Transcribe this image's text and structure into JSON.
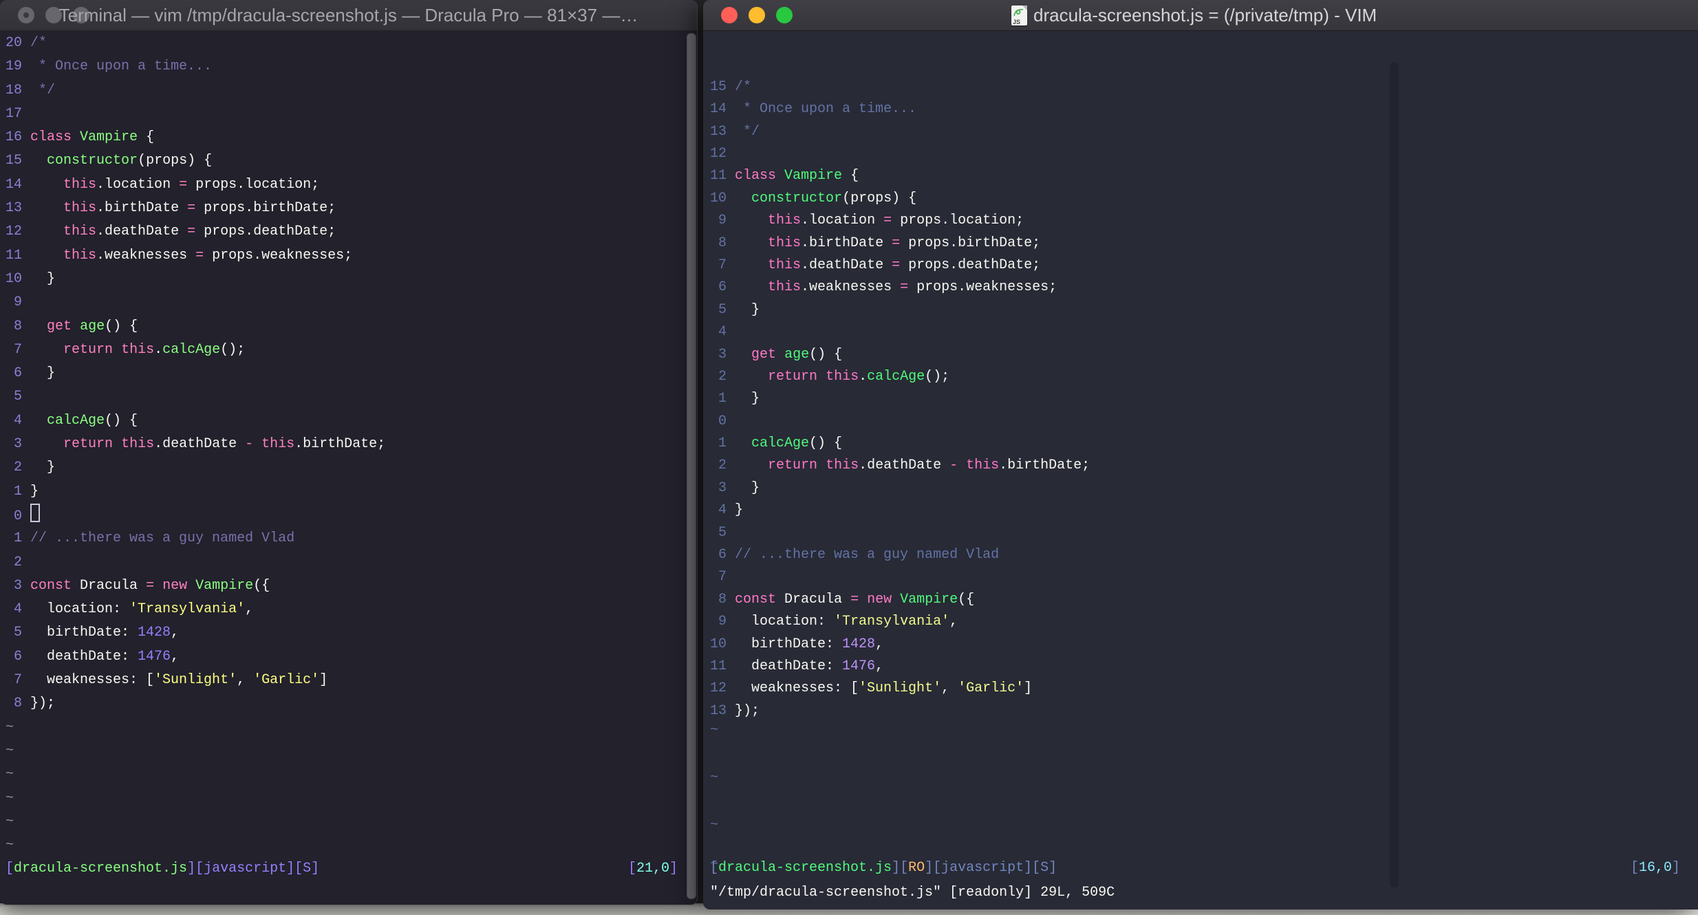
{
  "left_window": {
    "title": "Terminal — vim /tmp/dracula-screenshot.js — Dracula Pro — 81×37 —…",
    "cursor_line": 21,
    "tilde": "~",
    "tilde_count": 6,
    "gutter": [
      "20",
      "19",
      "18",
      "17",
      "16",
      "15",
      "14",
      "13",
      "12",
      "11",
      "10",
      " 9",
      " 8",
      " 7",
      " 6",
      " 5",
      " 4",
      " 3",
      " 2",
      " 1",
      " 0",
      " 1",
      " 2",
      " 3",
      " 4",
      " 5",
      " 6",
      " 7",
      " 8"
    ],
    "status": {
      "left": [
        [
          "br",
          "["
        ],
        [
          "file",
          "dracula-screenshot.js"
        ],
        [
          "br",
          "][javascript][S]"
        ]
      ],
      "right": [
        [
          "br",
          "["
        ],
        [
          "num",
          "21,0"
        ],
        [
          "br",
          "]"
        ]
      ]
    }
  },
  "right_window": {
    "title": "dracula-screenshot.js = (/private/tmp) - VIM",
    "icon_label": "JS",
    "cursor_line": 16,
    "tilde": "~",
    "tilde_count": 4,
    "gutter": [
      "15",
      "14",
      "13",
      "12",
      "11",
      "10",
      " 9",
      " 8",
      " 7",
      " 6",
      " 5",
      " 4",
      " 3",
      " 2",
      " 1",
      " 0",
      " 1",
      " 2",
      " 3",
      " 4",
      " 5",
      " 6",
      " 7",
      " 8",
      " 9",
      "10",
      "11",
      "12",
      "13"
    ],
    "status": {
      "left": [
        [
          "br",
          "["
        ],
        [
          "file",
          "dracula-screenshot.js"
        ],
        [
          "br",
          "]["
        ],
        [
          "ro",
          "RO"
        ],
        [
          "br",
          "][javascript][S]"
        ]
      ],
      "right": [
        [
          "br",
          "["
        ],
        [
          "num",
          "16,0"
        ],
        [
          "br",
          "]"
        ]
      ]
    },
    "cmdline": "\"/tmp/dracula-screenshot.js\" [readonly] 29L, 509C"
  },
  "code_lines": [
    {
      "toks": [
        [
          "c",
          "/*"
        ]
      ]
    },
    {
      "toks": [
        [
          "c",
          " * Once upon a time..."
        ]
      ]
    },
    {
      "toks": [
        [
          "c",
          " */"
        ]
      ]
    },
    {
      "toks": []
    },
    {
      "toks": [
        [
          "k",
          "class"
        ],
        [
          "v",
          " "
        ],
        [
          "f",
          "Vampire"
        ],
        [
          "v",
          " {"
        ]
      ]
    },
    {
      "toks": [
        [
          "v",
          "  "
        ],
        [
          "f",
          "constructor"
        ],
        [
          "v",
          "(props) {"
        ]
      ]
    },
    {
      "toks": [
        [
          "v",
          "    "
        ],
        [
          "k",
          "this"
        ],
        [
          "v",
          ".location "
        ],
        [
          "o",
          "="
        ],
        [
          "v",
          " props.location;"
        ]
      ]
    },
    {
      "toks": [
        [
          "v",
          "    "
        ],
        [
          "k",
          "this"
        ],
        [
          "v",
          ".birthDate "
        ],
        [
          "o",
          "="
        ],
        [
          "v",
          " props.birthDate;"
        ]
      ]
    },
    {
      "toks": [
        [
          "v",
          "    "
        ],
        [
          "k",
          "this"
        ],
        [
          "v",
          ".deathDate "
        ],
        [
          "o",
          "="
        ],
        [
          "v",
          " props.deathDate;"
        ]
      ]
    },
    {
      "toks": [
        [
          "v",
          "    "
        ],
        [
          "k",
          "this"
        ],
        [
          "v",
          ".weaknesses "
        ],
        [
          "o",
          "="
        ],
        [
          "v",
          " props.weaknesses;"
        ]
      ]
    },
    {
      "toks": [
        [
          "v",
          "  }"
        ]
      ]
    },
    {
      "toks": []
    },
    {
      "toks": [
        [
          "v",
          "  "
        ],
        [
          "k",
          "get"
        ],
        [
          "v",
          " "
        ],
        [
          "f",
          "age"
        ],
        [
          "v",
          "() {"
        ]
      ]
    },
    {
      "toks": [
        [
          "v",
          "    "
        ],
        [
          "k",
          "return"
        ],
        [
          "v",
          " "
        ],
        [
          "k",
          "this"
        ],
        [
          "v",
          "."
        ],
        [
          "f",
          "calcAge"
        ],
        [
          "v",
          "();"
        ]
      ]
    },
    {
      "toks": [
        [
          "v",
          "  }"
        ]
      ]
    },
    {
      "toks": []
    },
    {
      "toks": [
        [
          "v",
          "  "
        ],
        [
          "f",
          "calcAge"
        ],
        [
          "v",
          "() {"
        ]
      ]
    },
    {
      "toks": [
        [
          "v",
          "    "
        ],
        [
          "k",
          "return"
        ],
        [
          "v",
          " "
        ],
        [
          "k",
          "this"
        ],
        [
          "v",
          ".deathDate "
        ],
        [
          "o",
          "-"
        ],
        [
          "v",
          " "
        ],
        [
          "k",
          "this"
        ],
        [
          "v",
          ".birthDate;"
        ]
      ]
    },
    {
      "toks": [
        [
          "v",
          "  }"
        ]
      ]
    },
    {
      "toks": [
        [
          "v",
          "}"
        ]
      ]
    },
    {
      "toks": []
    },
    {
      "toks": [
        [
          "c",
          "// ...there was a guy named Vlad"
        ]
      ]
    },
    {
      "toks": []
    },
    {
      "toks": [
        [
          "k",
          "const"
        ],
        [
          "v",
          " Dracula "
        ],
        [
          "o",
          "="
        ],
        [
          "v",
          " "
        ],
        [
          "k",
          "new"
        ],
        [
          "v",
          " "
        ],
        [
          "f",
          "Vampire"
        ],
        [
          "v",
          "({"
        ]
      ]
    },
    {
      "toks": [
        [
          "v",
          "  location: "
        ],
        [
          "s",
          "'Transylvania'"
        ],
        [
          "v",
          ","
        ]
      ]
    },
    {
      "toks": [
        [
          "v",
          "  birthDate: "
        ],
        [
          "n",
          "1428"
        ],
        [
          "v",
          ","
        ]
      ]
    },
    {
      "toks": [
        [
          "v",
          "  deathDate: "
        ],
        [
          "n",
          "1476"
        ],
        [
          "v",
          ","
        ]
      ]
    },
    {
      "toks": [
        [
          "v",
          "  weaknesses: ["
        ],
        [
          "s",
          "'Sunlight'"
        ],
        [
          "v",
          ", "
        ],
        [
          "s",
          "'Garlic'"
        ],
        [
          "v",
          "]"
        ]
      ]
    },
    {
      "toks": [
        [
          "v",
          "});"
        ]
      ]
    }
  ],
  "palette": {
    "left": {
      "bg": "#22212C",
      "fg": "#F8F8F2",
      "comment": "#7970A9",
      "pink": "#FF80BF",
      "green": "#8AFF80",
      "yellow": "#FFFF80",
      "purple": "#9580FF",
      "cyan": "#80FFEA",
      "linenr": "#8C7FD4",
      "tilde": "#8F8F9C",
      "bracket": "#9580FF"
    },
    "right": {
      "bg": "#282A36",
      "fg": "#F8F8F2",
      "comment": "#6272A4",
      "pink": "#FF79C6",
      "green": "#50FA7B",
      "yellow": "#F1FA8C",
      "purple": "#BD93F9",
      "cyan": "#8BE9FD",
      "linenr": "#6272A4",
      "tilde": "#5E6C9E",
      "bracket": "#7286BE",
      "orange": "#FFB86C"
    }
  },
  "traffic_lights": {
    "close": "#FF5F57",
    "minimize": "#FEBC2E",
    "zoom": "#28C840"
  }
}
